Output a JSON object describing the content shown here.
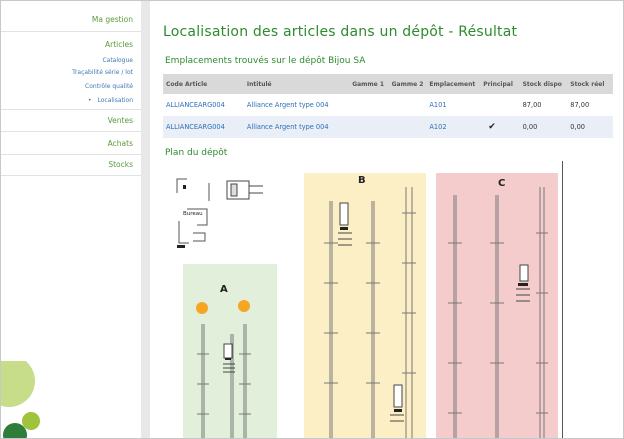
{
  "sidebar": {
    "items": [
      {
        "label": "Ma gestion"
      },
      {
        "label": "Articles"
      },
      {
        "label": "Ventes"
      },
      {
        "label": "Achats"
      },
      {
        "label": "Stocks"
      }
    ],
    "subitems": [
      {
        "label": "Catalogue"
      },
      {
        "label": "Traçabilité série / lot"
      },
      {
        "label": "Contrôle qualité"
      },
      {
        "label": "Localisation"
      }
    ],
    "active_bullet": "•"
  },
  "main": {
    "title": "Localisation des articles dans un dépôt - Résultat",
    "subtitle": "Emplacements trouvés sur le dépôt Bijou SA",
    "table": {
      "headers": [
        "Code Article",
        "Intitulé",
        "Gamme 1",
        "Gamme 2",
        "Emplacement",
        "Principal",
        "Stock dispo",
        "Stock réel"
      ],
      "rows": [
        {
          "code": "ALLIANCEARG004",
          "intitule": "Alliance Argent type 004",
          "gamme1": "",
          "gamme2": "",
          "emplacement": "A101",
          "principal": "",
          "dispo": "87,00",
          "reel": "87,00"
        },
        {
          "code": "ALLIANCEARG004",
          "intitule": "Alliance Argent type 004",
          "gamme1": "",
          "gamme2": "",
          "emplacement": "A102",
          "principal": "✔",
          "dispo": "0,00",
          "reel": "0,00"
        }
      ]
    },
    "plan_title": "Plan du dépôt",
    "plan": {
      "bureau_label": "Bureau",
      "zones": [
        {
          "label": "A",
          "color": "#e2efda"
        },
        {
          "label": "B",
          "color": "#fcefc6"
        },
        {
          "label": "C",
          "color": "#f4cccc"
        }
      ],
      "marker_color": "#f5a623"
    }
  },
  "colors": {
    "accent": "#2e8b2e",
    "link": "#2a6fb8"
  }
}
